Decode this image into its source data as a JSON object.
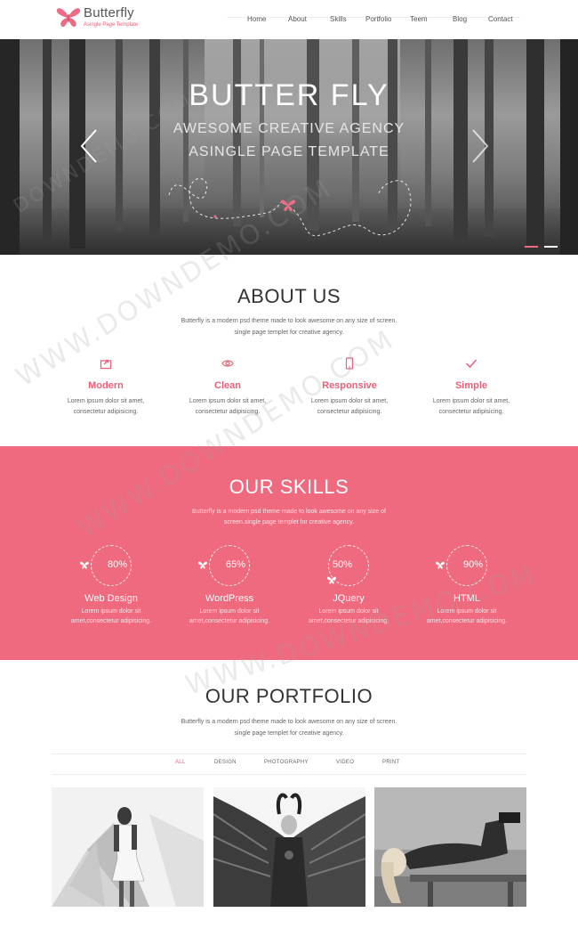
{
  "brand": {
    "name": "Butterfly",
    "tagline": "Asingle Page Template",
    "accent": "#e8607a"
  },
  "nav": {
    "items": [
      "Home",
      "About",
      "Skills",
      "Portfolio",
      "Teem",
      "Blog",
      "Contact"
    ]
  },
  "hero": {
    "title": "BUTTER FLY",
    "subtitle_line1": "AWESOME CREATIVE AGENCY",
    "subtitle_line2": "ASINGLE PAGE TEMPLATE",
    "prev_icon": "chevron-left-icon",
    "next_icon": "chevron-right-icon"
  },
  "about": {
    "title": "ABOUT US",
    "desc_line1": "Butterfly is a modern psd theme made to look awesome on any size of screen.",
    "desc_line2": "single page templet for creative agency.",
    "features": [
      {
        "icon": "export-icon",
        "title": "Modern",
        "text1": "Lorem ipsum dolor sit amet,",
        "text2": "consectetur adipisicing."
      },
      {
        "icon": "eye-icon",
        "title": "Clean",
        "text1": "Lorem ipsum dolor sit amet,",
        "text2": "consectetur adipisicing."
      },
      {
        "icon": "mobile-icon",
        "title": "Responsive",
        "text1": "Lorem ipsum dolor sit amet,",
        "text2": "consectetur adipisicing."
      },
      {
        "icon": "check-icon",
        "title": "Simple",
        "text1": "Lorem ipsum dolor sit amet,",
        "text2": "consectetur adipisicing."
      }
    ]
  },
  "skills": {
    "title": "OUR SKILLS",
    "desc_line1": "Butterfly is a modern psd theme made to look awesome on any size of",
    "desc_line2": "screen.single page templet for creative agency.",
    "background": "#ef6a7e",
    "items": [
      {
        "percent": "80%",
        "name": "Web Design",
        "text1": "Lorem ipsum dolor sit",
        "text2": "amet,consectetur adipisicing."
      },
      {
        "percent": "65%",
        "name": "WordPress",
        "text1": "Lorem ipsum dolor sit",
        "text2": "amet,consectetur adipisicing."
      },
      {
        "percent": "50%",
        "name": "JQuery",
        "text1": "Lorem ipsum dolor sit",
        "text2": "amet,consectetur adipisicing."
      },
      {
        "percent": "90%",
        "name": "HTML",
        "text1": "Lorem ipsum dolor sit",
        "text2": "amet,consectetur adipisicing."
      }
    ]
  },
  "portfolio": {
    "title": "OUR PORTFOLIO",
    "desc_line1": "Butterfly is a modern psd theme made to look awesome on any size of screen.",
    "desc_line2": "single page templet for creative agency.",
    "filters": [
      "ALL",
      "DESIGN",
      "PHOTOGRAPHY",
      "VIDEO",
      "PRINT"
    ],
    "active_filter": "ALL"
  },
  "watermark": {
    "text1": "WWW.DOWNDEMO.COM",
    "text2": "DOWNDEMO.COM"
  }
}
